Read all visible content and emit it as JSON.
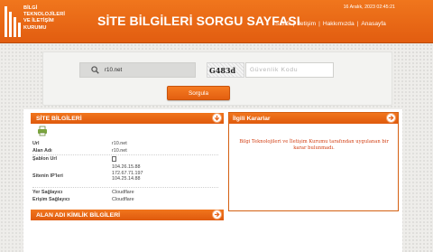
{
  "logo": {
    "lines": [
      "BİLGİ",
      "TEKNOLOJİLERİ",
      "VE İLETİŞİM",
      "KURUMU"
    ],
    "icon": "btk-logo"
  },
  "header": {
    "title": "SİTE BİLGİLERİ SORGU SAYFASI",
    "datetime": "16 Aralık, 2023 02:45:21",
    "nav": [
      "S.S.S",
      "İletişim",
      "Hakkımızda",
      "Anasayfa"
    ],
    "nav_separator": "|"
  },
  "query": {
    "search_value": "r10.net",
    "captcha_text": "G483d",
    "captcha_placeholder": "Güvenlik Kodu",
    "submit_label": "Sorgula"
  },
  "site_info": {
    "title": "SİTE BİLGİLERİ",
    "rows": [
      {
        "key": "Url",
        "value": "r10.net"
      },
      {
        "key": "Alan Adı",
        "value": "r10.net"
      },
      {
        "key": "Şablon Url",
        "value": ""
      },
      {
        "key": "Sitenin IP'leri",
        "value_lines": [
          "104.26.15.88",
          "172.67.71.197",
          "104.25.14.88"
        ]
      },
      {
        "key": "Yer Sağlayıcı",
        "value": "Cloudflare"
      },
      {
        "key": "Erişim Sağlayıcı",
        "value": "Cloudflare"
      }
    ]
  },
  "decisions": {
    "title": "İlgili Kararlar",
    "message": "Bilgi Teknolojileri ve İletişim Kurumu tarafından uygulanan bir karar bulunmadı."
  },
  "domain_identity": {
    "title": "ALAN ADI KİMLİK BİLGİLERİ"
  },
  "colors": {
    "brand_orange": "#e8651a",
    "message_red": "#d23e12"
  }
}
